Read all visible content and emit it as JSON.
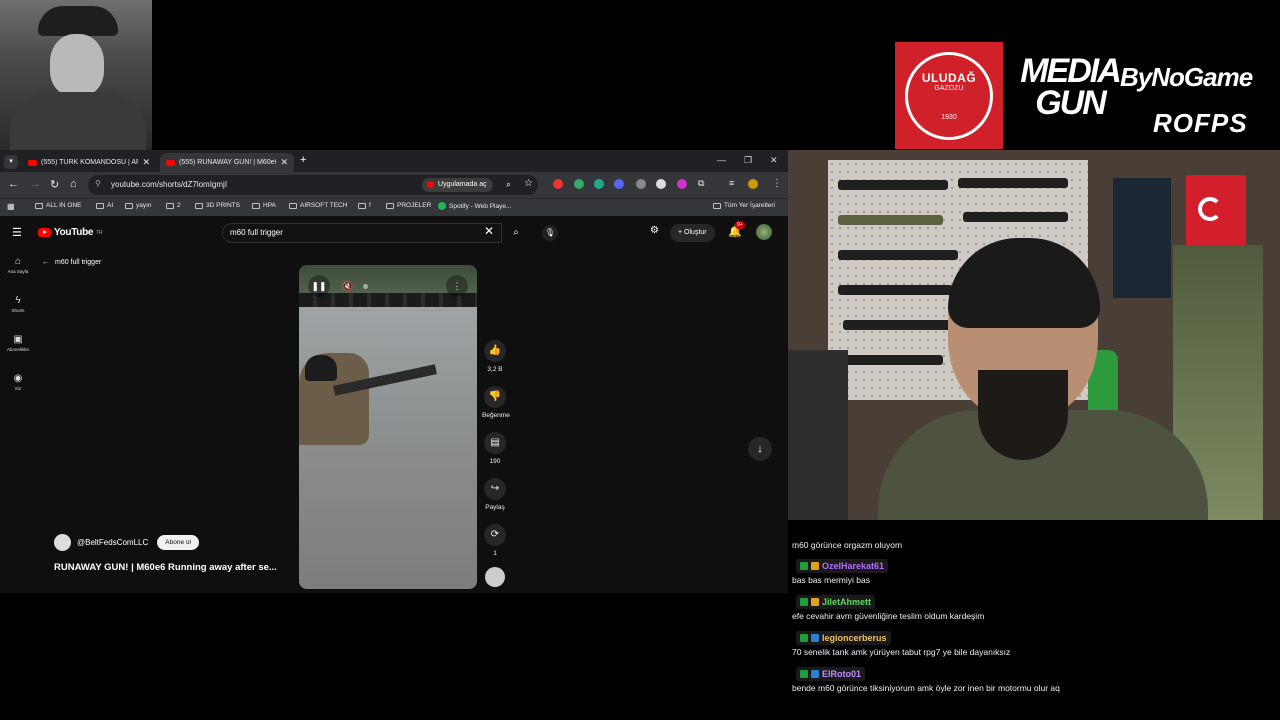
{
  "browser": {
    "tabs": [
      {
        "label": "(555) TÜRK KOMANDOSU | AF"
      },
      {
        "label": "(555) RUNAWAY GUN! | M60e6"
      }
    ],
    "new_tab": "+",
    "url": "youtube.com/shorts/dZ7lomIgmjI",
    "open_in_app": "Uygulamada aç",
    "bookmarks": [
      "ALL IN ONE",
      "AI",
      "yayın",
      "2",
      "3D PRINTS",
      "HPA",
      "AIRSOFT TECH",
      "f",
      "PROJELER",
      "Spotify - Web Playe..."
    ],
    "all_bookmarks": "Tüm Yer İşaretleri"
  },
  "youtube": {
    "logo": "YouTube",
    "logo_sup": "TR",
    "search_value": "m60 full trigger",
    "create": "Oluştur",
    "notif_count": "9+",
    "sidebar": [
      {
        "label": "Ana Sayfa"
      },
      {
        "label": "Shorts"
      },
      {
        "label": "Abonelikler"
      },
      {
        "label": "Siz"
      }
    ],
    "back_label": "m60 full trigger",
    "actions": {
      "like": "3,2 B",
      "dislike": "Beğenme",
      "comments": "190",
      "share": "Paylaş",
      "remix": "1"
    },
    "channel": "@BeltFedsComLLC",
    "subscribe": "Abone ol",
    "title": "RUNAWAY GUN! | M60e6 Running away after se..."
  },
  "overlay": {
    "uludag_name": "ULUDAĞ",
    "uludag_sub": "GAZOZU",
    "uludag_year": "1930",
    "media_gun": "MEDIA GUN",
    "bynogame": "ByNoGame",
    "rofps": "ROFPS"
  },
  "chat": {
    "messages": [
      {
        "user": "",
        "text": "m60 görünce orgazm oluyom"
      },
      {
        "user": "OzelHarekat61",
        "color": "#b36bff",
        "text": "bas bas mermiyi bas"
      },
      {
        "user": "JiletAhmett",
        "color": "#5cd65c",
        "text": "efe cevahir avm güvenliğine teslim oldum kardeşim"
      },
      {
        "user": "legioncerberus",
        "color": "#f0c060",
        "text": "70 senelik tank amk yürüyen tabut rpg7 ye bile dayanıksız"
      },
      {
        "user": "ElRoto01",
        "color": "#c48cff",
        "text": "bende m60 görünce tiksiniyorum amk öyle zor inen bir motormu olur aq"
      }
    ]
  }
}
